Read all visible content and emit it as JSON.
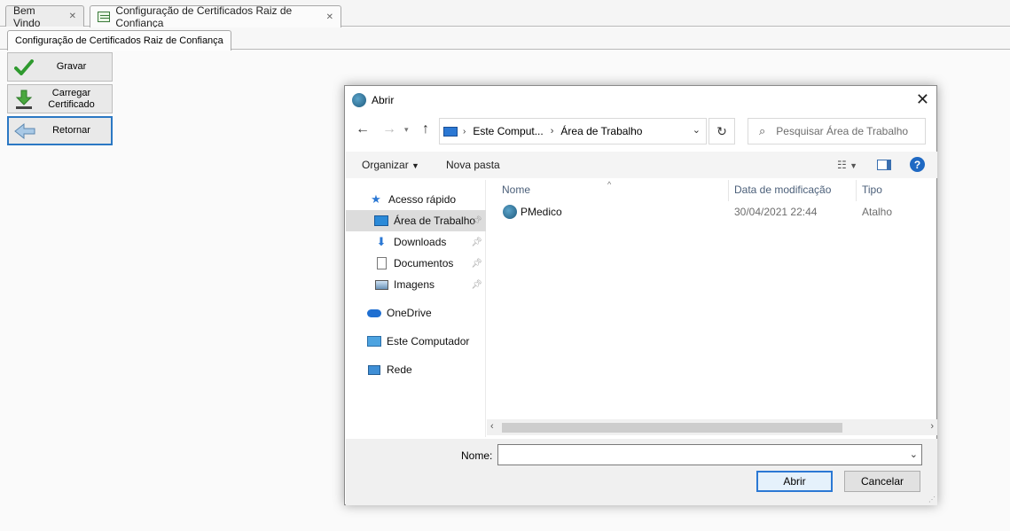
{
  "top_tabs": [
    {
      "label": "Bem Vindo",
      "close": "✕"
    },
    {
      "label": "Configuração de Certificados Raiz de Confiança",
      "close": "✕"
    }
  ],
  "sub_tab": {
    "label": "Configuração de Certificados Raiz de Confiança"
  },
  "left_buttons": {
    "save": "Gravar",
    "load": "Carregar Certificado",
    "back": "Retornar"
  },
  "dialog": {
    "title": "Abrir",
    "close": "✕",
    "address": {
      "part1": "Este Comput...",
      "part2": "Área de Trabalho"
    },
    "search_placeholder": "Pesquisar Área de Trabalho",
    "organize": "Organizar",
    "new_folder": "Nova pasta",
    "help": "?",
    "nav": {
      "quick": "Acesso rápido",
      "desktop": "Área de Trabalho",
      "downloads": "Downloads",
      "documents": "Documentos",
      "images": "Imagens",
      "onedrive": "OneDrive",
      "computer": "Este Computador",
      "network": "Rede"
    },
    "columns": {
      "name": "Nome",
      "date": "Data de modificação",
      "type": "Tipo"
    },
    "files": [
      {
        "name": "PMedico",
        "date": "30/04/2021 22:44",
        "type": "Atalho"
      }
    ],
    "filename_label": "Nome:",
    "filename_value": "",
    "open": "Abrir",
    "cancel": "Cancelar"
  }
}
